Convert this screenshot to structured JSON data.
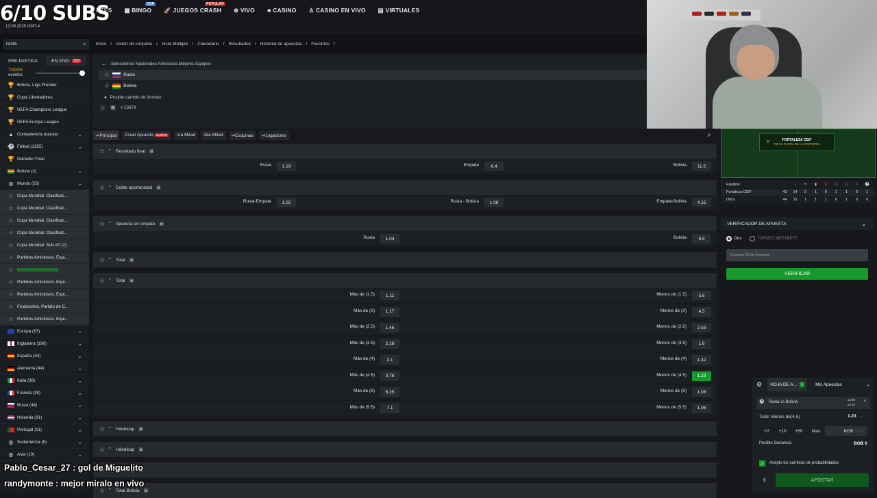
{
  "overlay": {
    "subs": "6/10 SUBS",
    "date": "13.09.2025",
    "tz": "GMT-4"
  },
  "nav": [
    {
      "label": "RTES",
      "icon": "sport-icon"
    },
    {
      "label": "BINGO",
      "icon": "bingo-icon",
      "tag": "TOP"
    },
    {
      "label": "JUEGOS CRASH",
      "icon": "rocket-icon",
      "tag": "POPULAR"
    },
    {
      "label": "VIVO",
      "icon": "live-icon"
    },
    {
      "label": "CASINO",
      "icon": "casino-icon"
    },
    {
      "label": "CASINO EN VIVO",
      "icon": "dealer-icon"
    },
    {
      "label": "VIRTUALES",
      "icon": "virtual-icon"
    }
  ],
  "search": {
    "value": "rusia"
  },
  "crumbs": [
    "Inicio",
    "Visión de conjunto",
    "Vista Múltiple",
    "Calendario",
    "Resultados",
    "Historial de apuestas",
    "Favoritos"
  ],
  "sidebar": {
    "tab_pre": "PRE-PARTIDA",
    "tab_live": "EN VIVO",
    "live_count": "159",
    "todos": "TODOS",
    "eventos": "eventos",
    "items": [
      {
        "label": "Bolivia. Liga Premier",
        "icon": "trophy-icon",
        "chev": false,
        "g": false
      },
      {
        "label": "Copa Libertadores",
        "icon": "trophy-icon",
        "chev": false,
        "g": false
      },
      {
        "label": "UEFA Champions League",
        "icon": "trophy-icon",
        "chev": false,
        "g": false
      },
      {
        "label": "UEFA Europa League",
        "icon": "trophy-icon",
        "chev": false,
        "g": false
      },
      {
        "label": "Competencia popular",
        "icon": "popular-icon",
        "chev": true,
        "g": false
      },
      {
        "label": "Fútbol (1355)",
        "icon": "football-icon",
        "chev": true,
        "g": false
      },
      {
        "label": "Ganador Final",
        "icon": "cup-icon",
        "chev": false,
        "g": false
      },
      {
        "label": "Bolivia (3)",
        "icon": "flag-bolivia-icon",
        "chev": true,
        "g": false
      },
      {
        "label": "Mundo (55)",
        "icon": "globe-icon",
        "chev": true,
        "g": false
      },
      {
        "label": "Copa Mundial. Clasificat...",
        "icon": "star-icon",
        "chev": false,
        "g": true
      },
      {
        "label": "Copa Mundial. Clasificat...",
        "icon": "star-icon",
        "chev": false,
        "g": true
      },
      {
        "label": "Copa Mundial. Clasificat...",
        "icon": "star-icon",
        "chev": false,
        "g": true
      },
      {
        "label": "Copa Mundial. Clasificat...",
        "icon": "star-icon",
        "chev": false,
        "g": true
      },
      {
        "label": "Copa Mundial. Sub-20 (2)",
        "icon": "star-icon",
        "chev": false,
        "g": true
      },
      {
        "label": "Partidos Amistosos. Equi...",
        "icon": "star-icon",
        "chev": false,
        "g": true
      },
      {
        "label": "",
        "icon": "star-icon",
        "chev": false,
        "g": true
      },
      {
        "label": "Partidos Amistosos. Equi...",
        "icon": "star-icon",
        "chev": false,
        "g": true
      },
      {
        "label": "Partidos Amistosos. Equi...",
        "icon": "star-icon",
        "chev": false,
        "g": true
      },
      {
        "label": "Finalissima. Partido de C...",
        "icon": "star-icon",
        "chev": false,
        "g": true
      },
      {
        "label": "Partidos Amistosos. Equi...",
        "icon": "star-icon",
        "chev": false,
        "g": true
      },
      {
        "label": "Europa (87)",
        "icon": "flag-eu-icon",
        "chev": true,
        "g": false
      },
      {
        "label": "Inglaterra (190)",
        "icon": "flag-england-icon",
        "chev": true,
        "g": false
      },
      {
        "label": "España (34)",
        "icon": "flag-spain-icon",
        "chev": true,
        "g": false
      },
      {
        "label": "Alemania (44)",
        "icon": "flag-germany-icon",
        "chev": true,
        "g": false
      },
      {
        "label": "Italia (38)",
        "icon": "flag-italy-icon",
        "chev": true,
        "g": false
      },
      {
        "label": "Francia (39)",
        "icon": "flag-france-icon",
        "chev": true,
        "g": false
      },
      {
        "label": "Rusia (44)",
        "icon": "flag-russia-icon",
        "chev": true,
        "g": false
      },
      {
        "label": "Holanda (31)",
        "icon": "flag-netherlands-icon",
        "chev": true,
        "g": false
      },
      {
        "label": "Portugal (11)",
        "icon": "flag-portugal-icon",
        "chev": true,
        "g": false
      },
      {
        "label": "Sudamerica (6)",
        "icon": "globe-icon",
        "chev": true,
        "g": false
      },
      {
        "label": "Asia (10)",
        "icon": "globe-icon",
        "chev": true,
        "g": false
      }
    ]
  },
  "event": {
    "league": "Selecciones Nacionales Amistosos.Mejores Equipos",
    "team1": "Rusia",
    "team2": "Bolivia",
    "note": "Posible cambio de formato",
    "id": "# 23679"
  },
  "market_tabs": [
    {
      "label": "Principal",
      "new": false
    },
    {
      "label": "Crear Apuesta",
      "new": true
    },
    {
      "label": "1ra Mitad",
      "new": false
    },
    {
      "label": "2da Mitad",
      "new": false
    },
    {
      "label": "Esquinas",
      "new": false
    },
    {
      "label": "Jugadores",
      "new": false
    }
  ],
  "new_tag": "NUEVO",
  "markets": {
    "m1": {
      "title": "Resultado final",
      "o": [
        [
          "Rusia",
          "1.19"
        ],
        [
          "Empate",
          "6.4"
        ],
        [
          "Bolivia",
          "11.5"
        ]
      ]
    },
    "m2": {
      "title": "Doble oportunidad",
      "o": [
        [
          "Rusia-Empate",
          "1.02"
        ],
        [
          "Rusia - Bolivia",
          "1.08"
        ],
        [
          "Empate-Bolivia",
          "4.15"
        ]
      ]
    },
    "m3": {
      "title": "Apuesta sin empate",
      "o": [
        [
          "Rusia",
          "1.04"
        ],
        [
          "Bolivia",
          "9.9"
        ]
      ]
    },
    "m4": {
      "title": "Total"
    },
    "m5": {
      "title": "Total",
      "rows": [
        [
          "Más de (1.5)",
          "1.11",
          "Menos de (1.5)",
          "5.6"
        ],
        [
          "Más de (2)",
          "1.17",
          "Menos de (2)",
          "4.5"
        ],
        [
          "Más de (2.5)",
          "1.46",
          "Menos de (2.5)",
          "2.53"
        ],
        [
          "Más de (3.5)",
          "2.18",
          "Menos de (3.5)",
          "1.6"
        ],
        [
          "Más de (4)",
          "3.1",
          "Menos de (4)",
          "1.32"
        ],
        [
          "Más de (4.5)",
          "3.76",
          "Menos de (4.5)",
          "1.23"
        ],
        [
          "Más de (5)",
          "6.25",
          "Menos de (5)",
          "1.08"
        ],
        [
          "Más de (5.5)",
          "7.1",
          "Menos de (5.5)",
          "1.06"
        ]
      ]
    },
    "m6": {
      "title": "Hándicap"
    },
    "m7": {
      "title": "Hándicap"
    },
    "m8": {
      "title": "Total Bolivia"
    }
  },
  "live": {
    "banner_title": "FORTALEZA CEIF",
    "banner_sub": "TIRAS FUERA DE LA PORTERIA",
    "col_label": "Equipos",
    "teams": [
      {
        "name": "Fortaleza CEIF",
        "vals": [
          "43",
          "14",
          "2",
          "1",
          "0",
          "1",
          "1",
          "0",
          "1"
        ]
      },
      {
        "name": "Olico",
        "vals": [
          "44",
          "16",
          "1",
          "1",
          "1",
          "0",
          "1",
          "0",
          "0"
        ]
      }
    ]
  },
  "verifier": {
    "title": "VERIFICADOR DE APUESTA",
    "opt1": "Otro",
    "opt2": "TORNEO METABETT",
    "placeholder": "Ingresar ID de Apuesta",
    "button": "VERIFICAR"
  },
  "betslip": {
    "tab1": "HOJA DE A...",
    "count": "1",
    "tab2": "Mis Apuestas",
    "match": "Rusia vs Bolivia",
    "time1": "13:00",
    "time2": "14:10",
    "pick": "Total: Menos de(4.5)",
    "odd": "1.23",
    "chips": [
      "+2",
      "+10",
      "+50",
      "Max"
    ],
    "currency": "BOB",
    "amount": "0.00",
    "gain_label": "Posible Ganancia",
    "gain": "BOB 0",
    "accept": "Acepto los cambios de probabilidades",
    "button": "APOSTAR"
  },
  "chat": [
    {
      "user": "Pablo_Cesar_27",
      "msg": ": gol de Miguelito"
    },
    {
      "user": "randymonte",
      "msg": ": mejor miralo en vivo"
    }
  ],
  "colors": {
    "accent_green": "#169a2b",
    "live_red": "#d72b3b",
    "gold": "#e4ad12"
  }
}
